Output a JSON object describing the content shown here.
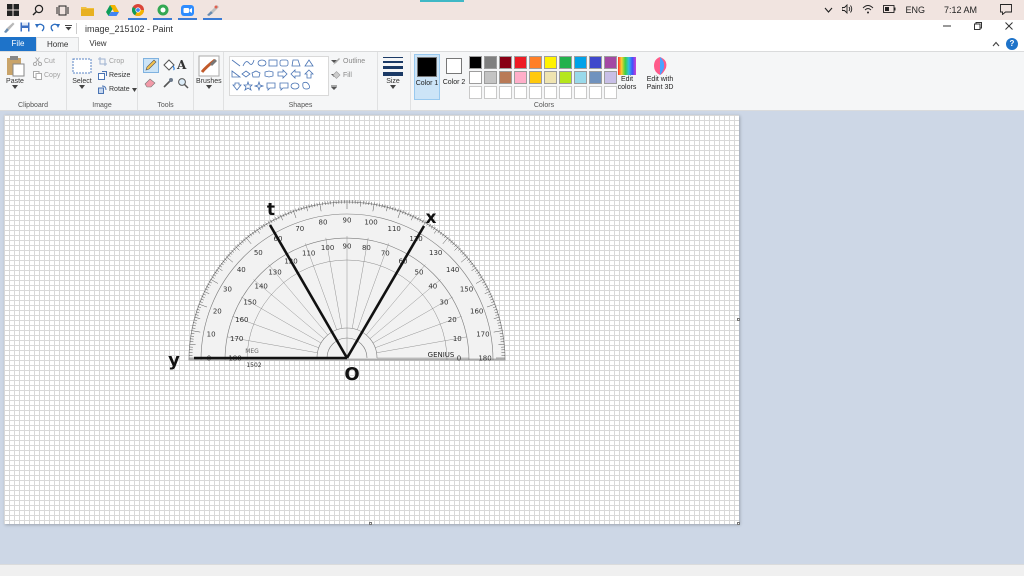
{
  "window": {
    "title": "image_215102 - Paint"
  },
  "taskbar": {
    "icons": [
      "windows-start-icon",
      "search-icon",
      "task-view-icon",
      "file-explorer-icon",
      "google-drive-icon",
      "chrome-icon",
      "app-green-icon",
      "zoom-icon",
      "paint-icon"
    ],
    "tray": {
      "language": "ENG",
      "time": "7:12 AM"
    }
  },
  "ribbon": {
    "tabs": [
      "File",
      "Home",
      "View"
    ],
    "clipboard": {
      "label": "Clipboard",
      "paste": "Paste",
      "cut": "Cut",
      "copy": "Copy"
    },
    "image": {
      "label": "Image",
      "select": "Select",
      "crop": "Crop",
      "resize": "Resize",
      "rotate": "Rotate"
    },
    "tools": {
      "label": "Tools"
    },
    "brushes": {
      "label": "Brushes"
    },
    "shapes": {
      "label": "Shapes",
      "outline": "Outline",
      "fill": "Fill"
    },
    "size": {
      "label": "Size"
    },
    "colors": {
      "label": "Colors",
      "color1": "Color 1",
      "color2": "Color 2",
      "edit_colors": "Edit colors",
      "edit_3d": "Edit with Paint 3D",
      "color1_value": "#000000",
      "color2_value": "#ffffff",
      "palette_row1": [
        "#000000",
        "#7f7f7f",
        "#880015",
        "#ed1c24",
        "#ff7f27",
        "#fff200",
        "#22b14c",
        "#00a2e8",
        "#3f48cc",
        "#a349a4"
      ],
      "palette_row2": [
        "#ffffff",
        "#c3c3c3",
        "#b97a57",
        "#ffaec9",
        "#ffc90e",
        "#efe4b0",
        "#b5e61d",
        "#99d9ea",
        "#7092be",
        "#c8bfe7"
      ]
    }
  },
  "drawing": {
    "labels": {
      "t": "t",
      "x": "x",
      "y": "y",
      "o": "O"
    },
    "protractor": {
      "outer_numbers": [
        "0",
        "10",
        "20",
        "30",
        "40",
        "50",
        "60",
        "70",
        "80",
        "90",
        "100",
        "110",
        "120",
        "130",
        "140",
        "150",
        "160",
        "170",
        "180"
      ],
      "brand": "GENIUS",
      "model": "1502",
      "mark": "MEG"
    }
  }
}
